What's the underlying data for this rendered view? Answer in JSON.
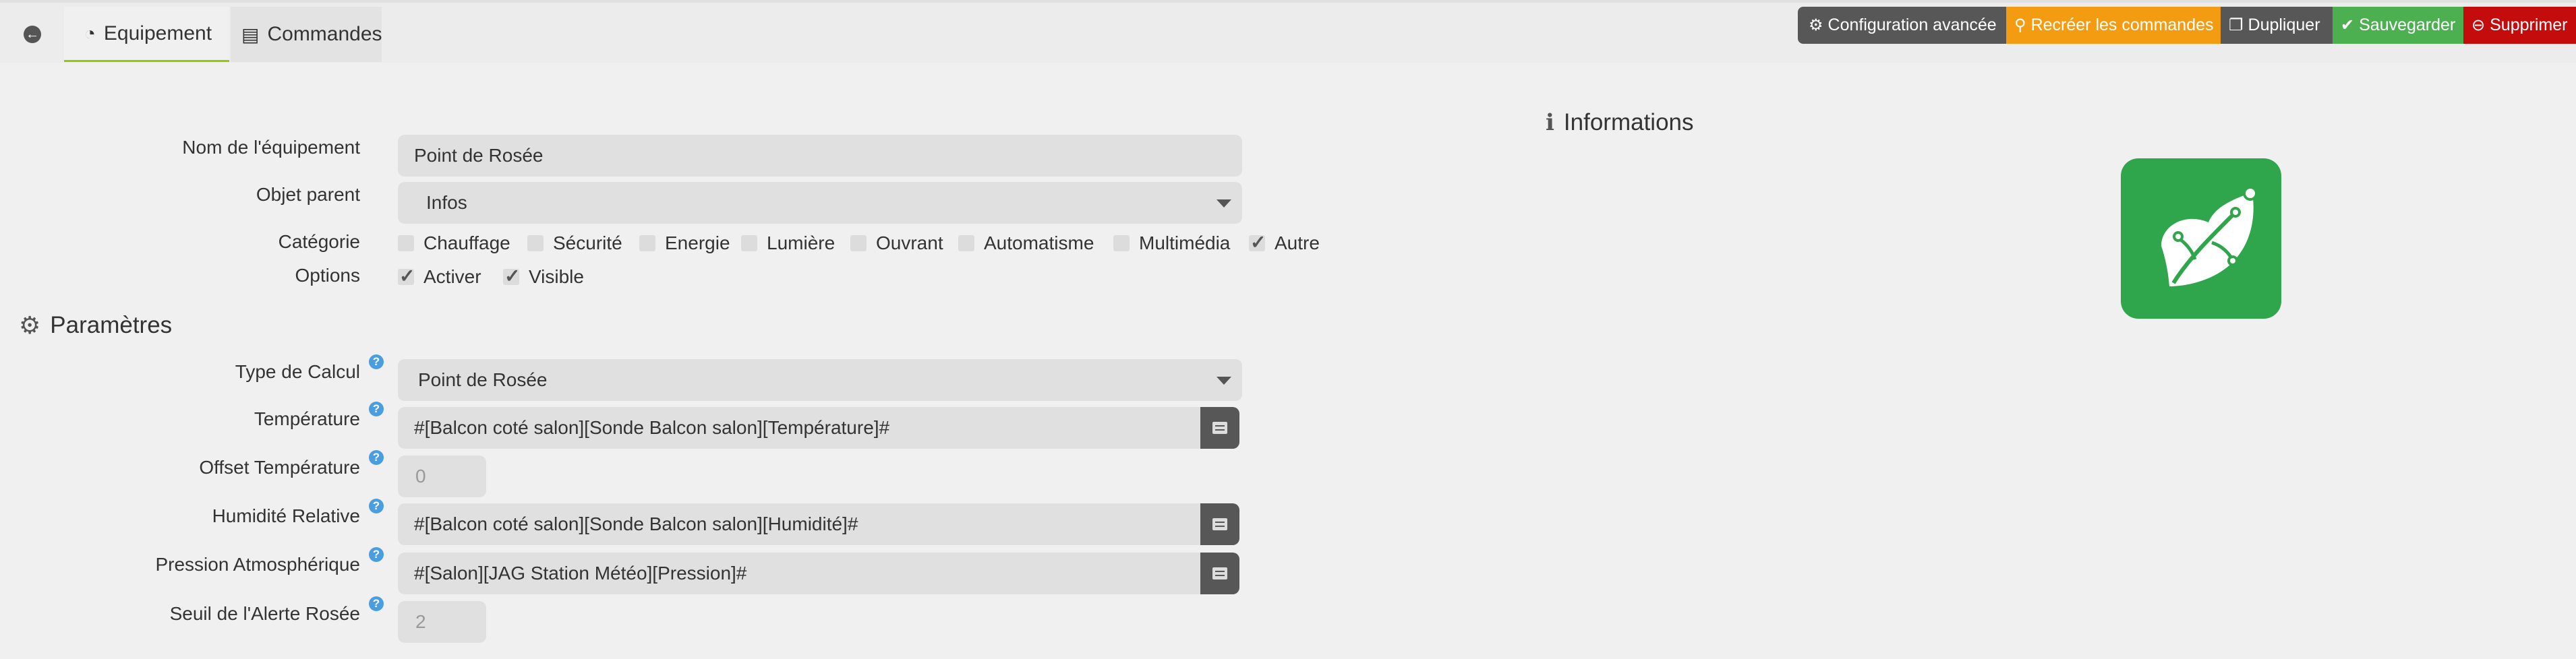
{
  "tabs": {
    "equipement": "Equipement",
    "commandes": "Commandes"
  },
  "actions": {
    "config": "Configuration avancée",
    "recreate": "Recréer les commandes",
    "duplicate": "Dupliquer",
    "save": "Sauvegarder",
    "delete": "Supprimer"
  },
  "equipment": {
    "name_label": "Nom de l'équipement",
    "name_value": "Point de Rosée",
    "parent_label": "Objet parent",
    "parent_value": "Infos",
    "category_label": "Catégorie",
    "categories": [
      {
        "label": "Chauffage",
        "checked": false
      },
      {
        "label": "Sécurité",
        "checked": false
      },
      {
        "label": "Energie",
        "checked": false
      },
      {
        "label": "Lumière",
        "checked": false
      },
      {
        "label": "Ouvrant",
        "checked": false
      },
      {
        "label": "Automatisme",
        "checked": false
      },
      {
        "label": "Multimédia",
        "checked": false
      },
      {
        "label": "Autre",
        "checked": true
      }
    ],
    "options_label": "Options",
    "options": [
      {
        "label": "Activer",
        "checked": true
      },
      {
        "label": "Visible",
        "checked": true
      }
    ]
  },
  "params": {
    "title": "Paramètres",
    "type_label": "Type de Calcul",
    "type_value": "Point de Rosée",
    "temp_label": "Température",
    "temp_value": "#[Balcon coté salon][Sonde Balcon salon][Température]#",
    "offset_label": "Offset Température",
    "offset_value": "0",
    "hum_label": "Humidité Relative",
    "hum_value": "#[Balcon coté salon][Sonde Balcon salon][Humidité]#",
    "press_label": "Pression Atmosphérique",
    "press_value": "#[Salon][JAG Station Météo][Pression]#",
    "alert_label": "Seuil de l'Alerte Rosée",
    "alert_value": "2"
  },
  "info": {
    "title": "Informations"
  },
  "colors": {
    "accent_green": "#94ca02",
    "plugin_green": "#2fa54c",
    "warning": "#f39c12",
    "success": "#4caf50",
    "danger": "#c50c0c",
    "dark": "#575757"
  }
}
